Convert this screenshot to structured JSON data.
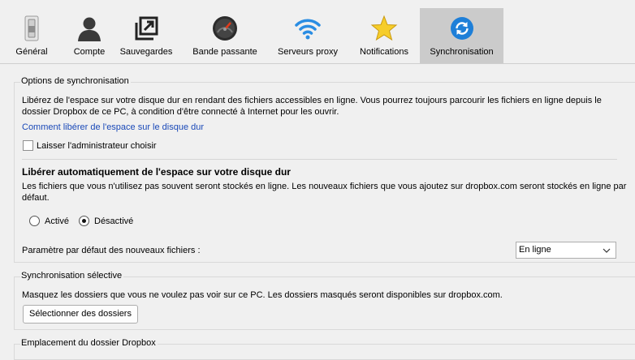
{
  "tabs": [
    {
      "label": "Général",
      "icon": "switch-icon"
    },
    {
      "label": "Compte",
      "icon": "user-icon"
    },
    {
      "label": "Sauvegardes",
      "icon": "backup-icon"
    },
    {
      "label": "Bande passante",
      "icon": "speedometer-icon"
    },
    {
      "label": "Serveurs proxy",
      "icon": "wifi-icon"
    },
    {
      "label": "Notifications",
      "icon": "star-icon"
    },
    {
      "label": "Synchronisation",
      "icon": "sync-icon",
      "active": true
    }
  ],
  "sync_options": {
    "title": "Options de synchronisation",
    "description_line1": "Libérez de l'espace sur votre disque dur en rendant des fichiers accessibles en ligne. Vous pourrez toujours parcourir les fichiers en ligne depuis le",
    "description_line2": "dossier Dropbox de ce PC, à condition d'être connecté à Internet pour les ouvrir.",
    "link": "Comment libérer de l'espace sur le disque dur",
    "checkbox_label": "Laisser l'administrateur choisir",
    "checkbox_checked": false,
    "auto_title": "Libérer automatiquement de l'espace sur votre disque dur",
    "auto_desc_line1": "Les fichiers que vous n'utilisez pas souvent seront stockés en ligne. Les nouveaux fichiers que vous ajoutez sur dropbox.com seront stockés en ligne par",
    "auto_desc_line2": "défaut.",
    "radio_on": "Activé",
    "radio_off": "Désactivé",
    "selected": "Désactivé",
    "default_label": "Paramètre par défaut des nouveaux fichiers :",
    "default_value": "En ligne"
  },
  "selective_sync": {
    "title": "Synchronisation sélective",
    "description": "Masquez les dossiers que vous ne voulez pas voir sur ce PC. Les dossiers masqués seront disponibles sur dropbox.com.",
    "button": "Sélectionner des dossiers"
  },
  "location": {
    "title": "Emplacement du dossier Dropbox"
  },
  "colors": {
    "link": "#1a49b8",
    "active_tab": "#cbcbcb",
    "sync_blue": "#1e7fd8"
  }
}
